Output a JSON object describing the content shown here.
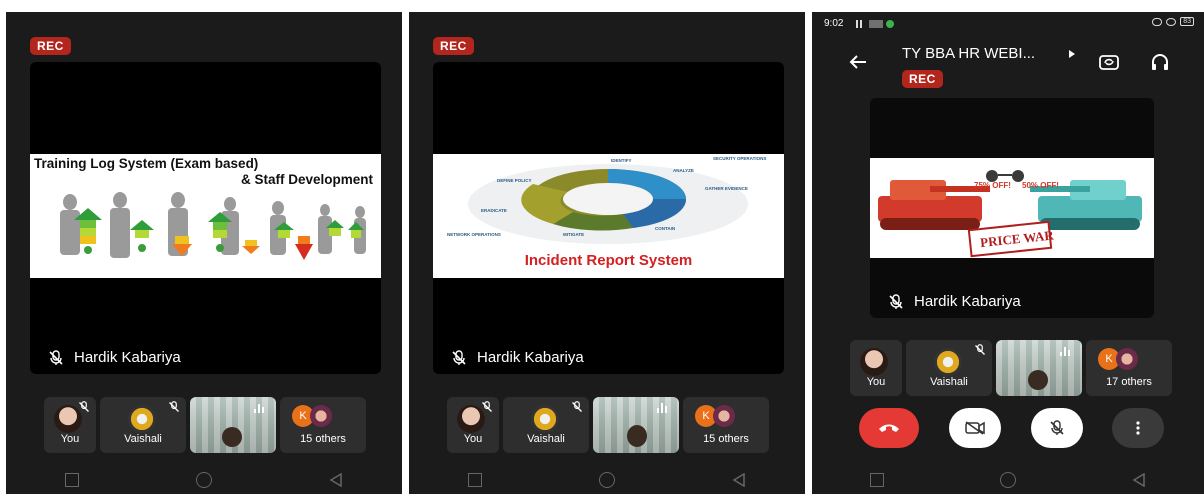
{
  "rec_label": "REC",
  "screens": [
    {
      "slide_title_1": "Training Log System (Exam based)",
      "slide_title_2": "& Staff Development",
      "speaker": "Hardik Kabariya",
      "participants": [
        "You",
        "Vaishali",
        "",
        "15 others"
      ],
      "others_initial": "K"
    },
    {
      "slide_caption": "Incident Report System",
      "wheel_labels": [
        "IDENTIFY",
        "SECURITY OPERATIONS",
        "ANALYZE",
        "GATHER EVIDENCE",
        "CONTAIN",
        "MITIGATE",
        "ERADICATE",
        "DEFINE POLICY",
        "NETWORK OPERATIONS"
      ],
      "speaker": "Hardik Kabariya",
      "participants": [
        "You",
        "Vaishali",
        "",
        "15 others"
      ],
      "others_initial": "K"
    },
    {
      "status_time": "9:02",
      "status_battery": "83",
      "meeting_title": "TY BBA HR WEBI...",
      "price_tags": [
        "75% OFF!",
        "50% OFF!"
      ],
      "price_war": "PRICE WAR",
      "speaker": "Hardik Kabariya",
      "participants": [
        "You",
        "Vaishali",
        "",
        "17 others"
      ],
      "others_initial": "K"
    }
  ]
}
